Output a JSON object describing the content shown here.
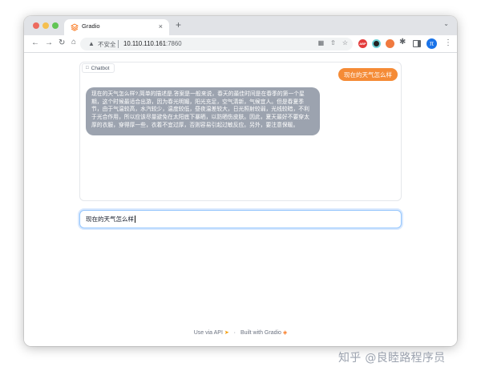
{
  "browser": {
    "tab_title": "Gradio",
    "new_tab_label": "+",
    "tab_close_label": "×",
    "security_label": "不安全",
    "url_host": "10.110.110.161",
    "url_port": ":7860",
    "abp_label": "ABP",
    "profile_initial": "π"
  },
  "chatbot": {
    "label": "Chatbot",
    "messages": [
      {
        "role": "user",
        "text": "现在的天气怎么样"
      },
      {
        "role": "bot",
        "text": "现在的天气怎么样?,简单的描述是,答案是一般来说，春天的最佳时间是在春季的第一个星期，这个时候最适合出游，因为春光明媚，阳光充足，空气清新，气候宜人。但是春夏季节，由于气温较高，水汽较少，温度较低，昼夜温差较大，日光照射较弱，光线较暗，不利于光合作用，所以应该尽量避免在太阳底下暴晒，以防晒伤皮肤。因此，夏天最好不要穿太厚的衣服，穿得厚一些，衣着不宜过厚，否则容易引起过敏反应。另外，要注意保暖。"
      }
    ]
  },
  "input": {
    "value": "现在的天气怎么样"
  },
  "footer": {
    "api_label": "Use via API",
    "separator": "·",
    "built_label": "Built with Gradio"
  },
  "watermark": "知乎 @良睦路程序员",
  "colors": {
    "user_bubble": "#f58b36",
    "bot_bubble": "#9ca3af",
    "input_focus": "#93c5fd",
    "profile": "#1a73e8"
  }
}
